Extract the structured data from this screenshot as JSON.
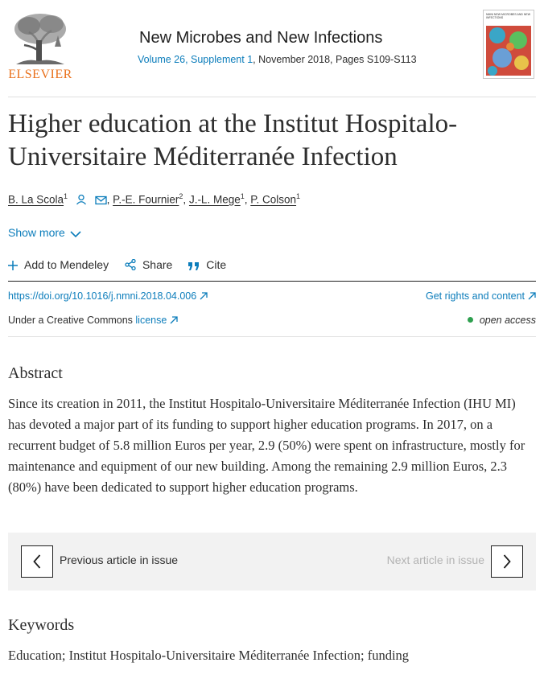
{
  "publisher": {
    "name": "ELSEVIER",
    "logo_icon": "elsevier-tree-icon"
  },
  "journal": {
    "title": "New Microbes and New Infections",
    "volume_link": "Volume 26, Supplement 1",
    "issue_info": ", November 2018, Pages S109-S113",
    "cover_text": "NMNI NEW MICROBES AND NEW INFECTIONS"
  },
  "article": {
    "title": "Higher education at the Institut Hospitalo-Universitaire Méditerranée Infection",
    "authors": [
      {
        "name": "B. La Scola",
        "aff": "1"
      },
      {
        "name": "P.-E. Fournier",
        "aff": "2"
      },
      {
        "name": "J.-L. Mege",
        "aff": "1"
      },
      {
        "name": "P. Colson",
        "aff": "1"
      }
    ],
    "show_more": "Show more"
  },
  "actions": {
    "mendeley": "Add to Mendeley",
    "share": "Share",
    "cite": "Cite"
  },
  "links": {
    "doi": "https://doi.org/10.1016/j.nmni.2018.04.006",
    "rights": "Get rights and content",
    "license_prefix": "Under a Creative Commons ",
    "license_link": "license",
    "open_access": "open access"
  },
  "abstract": {
    "heading": "Abstract",
    "text": "Since its creation in 2011, the Institut Hospitalo-Universitaire Méditerranée Infection (IHU MI) has devoted a major part of its funding to support higher education programs. In 2017, on a recurrent budget of 5.8 million Euros per year, 2.9 (50%) were spent on infrastructure, mostly for maintenance and equipment of our new building. Among the remaining 2.9 million Euros, 2.3 (80%) have been dedicated to support higher education programs."
  },
  "navigation": {
    "previous": "Previous article in issue",
    "next": "Next article in issue"
  },
  "keywords": {
    "heading": "Keywords",
    "text": "Education; Institut Hospitalo-Universitaire Méditerranée Infection; funding"
  },
  "colors": {
    "link": "#0c7dbb",
    "elsevier_orange": "#e9711c",
    "open_access_dot": "#2ea04f",
    "nav_bg": "#f2f2f2"
  }
}
